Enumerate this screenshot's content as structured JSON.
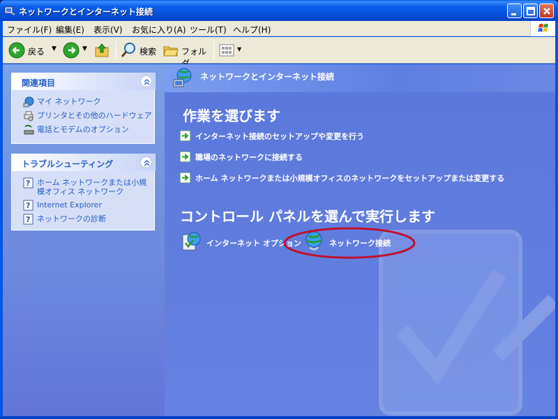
{
  "window": {
    "title": "ネットワークとインターネット接続",
    "title_icon": "control-panel-icon",
    "controls": [
      "minimize-icon",
      "maximize-icon",
      "close-icon"
    ]
  },
  "menubar": {
    "items": [
      "ファイル(F)",
      "編集(E)",
      "表示(V)",
      "お気に入り(A)",
      "ツール(T)",
      "ヘルプ(H)"
    ]
  },
  "toolbar": {
    "back_label": "戻る",
    "search_label": "検索",
    "folders_label": "フォルダ"
  },
  "left_pane": {
    "related": {
      "title": "関連項目",
      "items": [
        {
          "label": "マイ ネットワーク",
          "icon": "my-network-icon"
        },
        {
          "label": "プリンタとその他のハードウェア",
          "icon": "printer-icon"
        },
        {
          "label": "電話とモデムのオプション",
          "icon": "phone-modem-icon"
        }
      ]
    },
    "troubleshoot": {
      "title": "トラブルシューティング",
      "items": [
        {
          "label": "ホーム ネットワークまたは小規",
          "label2": "模オフィス ネットワーク",
          "icon": "help-icon"
        },
        {
          "label": "Internet Explorer",
          "icon": "help-icon"
        },
        {
          "label": "ネットワークの診断",
          "icon": "help-icon"
        }
      ]
    }
  },
  "main": {
    "header_title": "ネットワークとインターネット接続",
    "tasks_title": "作業を選びます",
    "tasks": [
      "インターネット接続のセットアップや変更を行う",
      "職場のネットワークに接続する",
      "ホーム ネットワークまたは小規模オフィスのネットワークをセットアップまたは変更する"
    ],
    "cp_title": "コントロール パネルを選んで実行します",
    "cp_items": [
      {
        "label": "インターネット オプション",
        "icon": "internet-options-icon"
      },
      {
        "label": "ネットワーク接続",
        "icon": "network-connections-icon"
      }
    ]
  },
  "colors": {
    "titlebar": "#0054e3",
    "left_pane": "#7ba2e7",
    "right_pane": "#5a78dc",
    "highlight_ellipse": "#c0102a"
  }
}
